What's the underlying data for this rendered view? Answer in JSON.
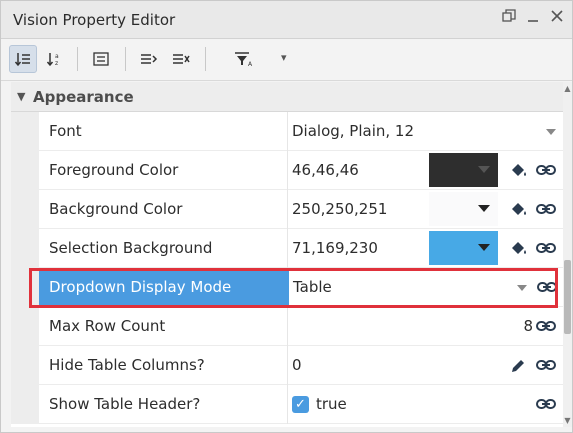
{
  "window": {
    "title": "Vision Property Editor"
  },
  "toolbar": {
    "icons": [
      "sort-ascending-icon",
      "sort-alpha-icon",
      "list-view-icon",
      "expand-all-icon",
      "collapse-all-icon",
      "filter-icon"
    ]
  },
  "group": {
    "label": "Appearance",
    "expanded": true
  },
  "properties": [
    {
      "name": "Font",
      "value": "Dialog, Plain, 12"
    },
    {
      "name": "Foreground Color",
      "value": "46,46,46",
      "swatch": "#2e2e2e"
    },
    {
      "name": "Background Color",
      "value": "250,250,251",
      "swatch": "#fafafb"
    },
    {
      "name": "Selection Background",
      "value": "71,169,230",
      "swatch": "#47a9e6"
    },
    {
      "name": "Dropdown Display Mode",
      "value": "Table",
      "selected": true
    },
    {
      "name": "Max Row Count",
      "value": "8"
    },
    {
      "name": "Hide Table Columns?",
      "value": "0"
    },
    {
      "name": "Show Table Header?",
      "value": "true",
      "checked": true
    }
  ],
  "colors": {
    "selection": "#4a9be0",
    "highlight_border": "#e0313b"
  }
}
